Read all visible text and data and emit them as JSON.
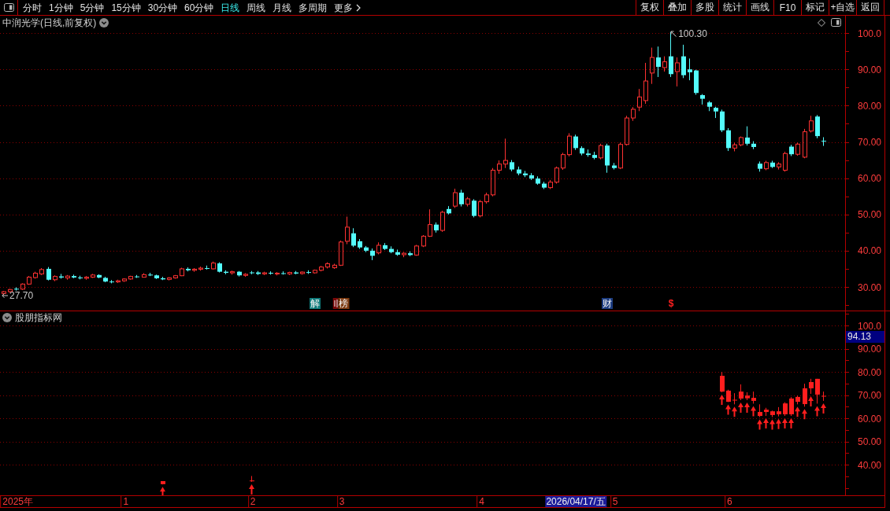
{
  "toolbar": {
    "periods": [
      {
        "label": "分时",
        "kind": "period",
        "selected": false
      },
      {
        "label": "1分钟",
        "kind": "period",
        "selected": false
      },
      {
        "label": "5分钟",
        "kind": "period",
        "selected": false
      },
      {
        "label": "15分钟",
        "kind": "period",
        "selected": false
      },
      {
        "label": "30分钟",
        "kind": "period",
        "selected": false
      },
      {
        "label": "60分钟",
        "kind": "period",
        "selected": false
      },
      {
        "label": "日线",
        "kind": "period",
        "selected": true
      },
      {
        "label": "周线",
        "kind": "period",
        "selected": false
      },
      {
        "label": "月线",
        "kind": "period",
        "selected": false
      },
      {
        "label": "多周期",
        "kind": "period",
        "selected": false
      },
      {
        "label": "更多",
        "kind": "menu",
        "selected": false
      }
    ],
    "actions": [
      "复权",
      "叠加",
      "多股",
      "统计",
      "画线",
      "F10",
      "标记",
      "+自选",
      "返回"
    ]
  },
  "main_pane": {
    "title": "中润光学(日线,前复权)",
    "high_marker": "100.30",
    "low_marker": "27.70",
    "events": [
      {
        "kind": "tag",
        "color": "#0f7a7a"
      },
      {
        "kind": "tag",
        "color": "#7d3a10",
        "covered_tag": {
          "color": "#7a0808"
        }
      },
      {
        "kind": "tag",
        "color": "#1c3c80"
      },
      {
        "kind": "symbol",
        "color": "#ff2020"
      }
    ],
    "chart_data": [
      {
        "type": "candlestick",
        "grid": true,
        "ylim": [
          23.5,
          104.8
        ],
        "yticks": [
          {
            "value": 100,
            "label": "100.0"
          },
          {
            "value": 90,
            "label": "90.00"
          },
          {
            "value": 80,
            "label": "80.00"
          },
          {
            "value": 70,
            "label": "70.00"
          },
          {
            "value": 60,
            "label": "60.00"
          },
          {
            "value": 50,
            "label": "50.00"
          },
          {
            "value": 40,
            "label": "40.00"
          },
          {
            "value": 30,
            "label": "30.00"
          }
        ],
        "categories": [
          null,
          null,
          null,
          null,
          null,
          null,
          null,
          null,
          null,
          null,
          null,
          null,
          null,
          null,
          null,
          null,
          null,
          null,
          null,
          null,
          null,
          null,
          null,
          null,
          null,
          null,
          null,
          null,
          null,
          null,
          null,
          null,
          null,
          null,
          null,
          null,
          null,
          null,
          null,
          null,
          null,
          null,
          null,
          null,
          null,
          null,
          null,
          null,
          null,
          "解",
          null,
          null,
          null,
          "榜",
          null,
          null,
          null,
          null,
          null,
          null,
          null,
          null,
          null,
          null,
          null,
          null,
          null,
          null,
          null,
          null,
          null,
          null,
          null,
          null,
          null,
          null,
          null,
          null,
          null,
          null,
          null,
          null,
          null,
          null,
          null,
          null,
          null,
          null,
          null,
          null,
          null,
          null,
          null,
          null,
          null,
          "财",
          null,
          null,
          null,
          null,
          null,
          null,
          null,
          null,
          null,
          "$",
          null,
          null,
          null,
          null,
          null,
          null,
          null,
          null,
          null,
          null,
          null,
          null,
          null,
          null,
          null,
          null,
          null,
          null,
          null,
          null,
          null,
          null,
          null,
          null,
          null,
          null,
          null
        ],
        "ohlc": [
          [
            28.2,
            28.9,
            27.7,
            28.7
          ],
          [
            28.7,
            29.5,
            28.4,
            29.3
          ],
          [
            29.4,
            29.9,
            29.0,
            29.4
          ],
          [
            29.4,
            31.0,
            29.2,
            30.8
          ],
          [
            30.8,
            33.0,
            30.6,
            32.7
          ],
          [
            32.6,
            34.2,
            32.3,
            33.8
          ],
          [
            33.6,
            35.2,
            33.3,
            34.8
          ],
          [
            35.0,
            35.5,
            31.8,
            32.0
          ],
          [
            32.0,
            33.2,
            31.6,
            32.9
          ],
          [
            32.9,
            33.6,
            32.3,
            32.6
          ],
          [
            32.5,
            33.3,
            32.0,
            33.0
          ],
          [
            33.0,
            33.4,
            32.4,
            32.6
          ],
          [
            32.6,
            33.1,
            32.1,
            32.4
          ],
          [
            32.4,
            33.0,
            32.0,
            32.7
          ],
          [
            32.7,
            33.6,
            32.5,
            33.3
          ],
          [
            33.3,
            33.5,
            32.4,
            32.6
          ],
          [
            32.5,
            32.8,
            31.3,
            31.5
          ],
          [
            31.5,
            31.9,
            31.0,
            31.4
          ],
          [
            31.4,
            32.0,
            31.1,
            31.7
          ],
          [
            31.7,
            32.4,
            31.4,
            32.2
          ],
          [
            32.2,
            33.1,
            32.0,
            32.9
          ],
          [
            32.9,
            33.3,
            32.5,
            32.7
          ],
          [
            32.7,
            33.8,
            32.6,
            33.4
          ],
          [
            33.4,
            33.9,
            33.0,
            33.3
          ],
          [
            33.2,
            33.4,
            32.2,
            32.4
          ],
          [
            32.4,
            32.8,
            31.9,
            32.1
          ],
          [
            32.1,
            32.7,
            31.8,
            32.5
          ],
          [
            32.5,
            33.3,
            32.3,
            33.1
          ],
          [
            33.1,
            35.3,
            33.0,
            35.0
          ],
          [
            35.0,
            35.4,
            34.3,
            34.6
          ],
          [
            34.6,
            35.2,
            34.2,
            34.9
          ],
          [
            34.9,
            35.6,
            34.5,
            35.2
          ],
          [
            35.2,
            35.9,
            34.8,
            35.0
          ],
          [
            35.0,
            37.0,
            34.8,
            36.6
          ],
          [
            36.5,
            36.8,
            34.0,
            34.2
          ],
          [
            34.2,
            34.6,
            33.5,
            33.9
          ],
          [
            33.9,
            34.5,
            33.4,
            34.2
          ],
          [
            34.2,
            34.4,
            32.9,
            33.2
          ],
          [
            33.2,
            33.8,
            32.8,
            33.5
          ],
          [
            33.9,
            34.4,
            33.5,
            33.9
          ],
          [
            34.0,
            34.4,
            33.3,
            33.6
          ],
          [
            33.6,
            34.2,
            33.3,
            33.9
          ],
          [
            33.9,
            34.3,
            33.4,
            33.7
          ],
          [
            33.7,
            34.1,
            33.2,
            33.8
          ],
          [
            33.8,
            34.3,
            33.4,
            33.6
          ],
          [
            33.6,
            34.2,
            33.3,
            34.0
          ],
          [
            34.0,
            34.4,
            33.5,
            33.7
          ],
          [
            33.7,
            34.3,
            33.4,
            34.1
          ],
          [
            34.1,
            34.6,
            33.6,
            33.9
          ],
          [
            33.9,
            34.8,
            33.7,
            34.6
          ],
          [
            34.6,
            35.8,
            34.3,
            35.5
          ],
          [
            35.5,
            36.8,
            35.1,
            36.4
          ],
          [
            35.3,
            36.4,
            35.0,
            36.0
          ],
          [
            36.0,
            42.8,
            35.8,
            42.4
          ],
          [
            42.6,
            49.4,
            41.8,
            46.5
          ],
          [
            44.8,
            46.2,
            41.0,
            41.4
          ],
          [
            42.6,
            43.2,
            40.5,
            40.9
          ],
          [
            40.9,
            41.3,
            39.6,
            40.0
          ],
          [
            40.0,
            40.6,
            37.4,
            38.6
          ],
          [
            39.4,
            42.3,
            39.0,
            41.5
          ],
          [
            41.5,
            42.1,
            40.2,
            40.5
          ],
          [
            40.5,
            41.2,
            39.3,
            39.6
          ],
          [
            39.6,
            40.3,
            38.6,
            38.9
          ],
          [
            38.9,
            39.6,
            38.2,
            39.3
          ],
          [
            39.3,
            39.8,
            38.5,
            38.8
          ],
          [
            38.8,
            41.6,
            38.6,
            41.3
          ],
          [
            41.3,
            44.3,
            41.0,
            44.0
          ],
          [
            44.0,
            51.4,
            43.8,
            47.2
          ],
          [
            47.2,
            47.8,
            45.0,
            45.6
          ],
          [
            45.6,
            51.0,
            45.2,
            50.6
          ],
          [
            51.5,
            52.3,
            50.0,
            50.3
          ],
          [
            52.3,
            57.1,
            51.8,
            56.0
          ],
          [
            56.0,
            56.8,
            52.2,
            52.8
          ],
          [
            52.8,
            54.8,
            52.2,
            54.3
          ],
          [
            53.8,
            54.2,
            49.2,
            49.6
          ],
          [
            49.6,
            54.0,
            49.2,
            53.5
          ],
          [
            53.5,
            56.0,
            53.0,
            55.4
          ],
          [
            55.4,
            62.8,
            55.0,
            62.2
          ],
          [
            62.2,
            64.9,
            61.2,
            63.9
          ],
          [
            63.9,
            70.9,
            62.8,
            64.9
          ],
          [
            64.4,
            65.0,
            61.9,
            62.4
          ],
          [
            62.4,
            63.2,
            60.8,
            61.3
          ],
          [
            61.3,
            62.0,
            60.3,
            60.8
          ],
          [
            60.8,
            61.4,
            59.5,
            59.9
          ],
          [
            59.9,
            60.5,
            58.2,
            58.5
          ],
          [
            58.5,
            59.0,
            57.0,
            57.4
          ],
          [
            57.4,
            59.5,
            57.0,
            58.9
          ],
          [
            58.9,
            63.2,
            58.5,
            62.8
          ],
          [
            62.8,
            67.0,
            62.3,
            66.5
          ],
          [
            66.5,
            72.4,
            66.0,
            71.6
          ],
          [
            71.5,
            72.0,
            67.8,
            68.3
          ],
          [
            68.3,
            68.8,
            66.3,
            66.8
          ],
          [
            66.8,
            67.9,
            65.9,
            66.4
          ],
          [
            66.4,
            67.3,
            65.2,
            65.6
          ],
          [
            65.6,
            69.5,
            65.2,
            69.0
          ],
          [
            69.0,
            69.5,
            61.5,
            63.5
          ],
          [
            63.5,
            64.2,
            62.4,
            62.8
          ],
          [
            62.8,
            69.8,
            62.5,
            69.3
          ],
          [
            69.3,
            77.2,
            69.0,
            76.6
          ],
          [
            76.6,
            79.6,
            75.8,
            79.0
          ],
          [
            79.6,
            84.6,
            78.5,
            82.4
          ],
          [
            81.4,
            91.8,
            80.5,
            86.8
          ],
          [
            89.0,
            96.0,
            86.0,
            93.3
          ],
          [
            93.3,
            96.3,
            87.9,
            90.7
          ],
          [
            90.5,
            93.6,
            89.4,
            92.1
          ],
          [
            93.6,
            100.3,
            87.9,
            88.7
          ],
          [
            89.4,
            93.3,
            85.3,
            91.8
          ],
          [
            93.6,
            96.8,
            87.6,
            88.4
          ],
          [
            90.0,
            93.0,
            87.0,
            89.2
          ],
          [
            89.7,
            89.9,
            83.0,
            83.5
          ],
          [
            82.9,
            83.2,
            80.3,
            81.9
          ],
          [
            80.9,
            81.3,
            78.5,
            79.7
          ],
          [
            79.4,
            79.7,
            76.6,
            78.4
          ],
          [
            78.4,
            78.9,
            72.7,
            73.2
          ],
          [
            73.2,
            73.8,
            67.5,
            68.3
          ],
          [
            68.3,
            69.8,
            67.4,
            69.2
          ],
          [
            69.2,
            71.5,
            68.8,
            71.2
          ],
          [
            71.2,
            74.3,
            69.0,
            69.5
          ],
          [
            69.5,
            70.2,
            68.0,
            68.6
          ],
          [
            64.0,
            64.6,
            61.8,
            62.6
          ],
          [
            62.6,
            64.8,
            62.2,
            64.3
          ],
          [
            64.3,
            64.8,
            62.8,
            63.1
          ],
          [
            63.1,
            64.4,
            62.4,
            63.9
          ],
          [
            62.2,
            67.3,
            61.8,
            66.8
          ],
          [
            68.7,
            69.2,
            66.1,
            66.6
          ],
          [
            66.6,
            69.8,
            66.2,
            69.4
          ],
          [
            65.8,
            73.6,
            65.5,
            72.8
          ],
          [
            73.0,
            77.2,
            72.6,
            75.8
          ],
          [
            77.0,
            77.4,
            71.0,
            71.6
          ],
          [
            70.2,
            71.3,
            68.9,
            70.2
          ],
          null,
          null,
          null
        ],
        "colors": [
          "#ff3232",
          "#ff3232",
          "#54fcfc",
          "#ff3232",
          "#ff3232",
          "#ff3232",
          "#ff3232",
          "#54fcfc",
          "#ff3232",
          "#54fcfc",
          "#ff3232",
          "#54fcfc",
          "#54fcfc",
          "#ff3232",
          "#ff3232",
          "#54fcfc",
          "#54fcfc",
          "#54fcfc",
          "#ff3232",
          "#ff3232",
          "#ff3232",
          "#54fcfc",
          "#ff3232",
          "#54fcfc",
          "#54fcfc",
          "#54fcfc",
          "#ff3232",
          "#ff3232",
          "#ff3232",
          "#54fcfc",
          "#ff3232",
          "#ff3232",
          "#54fcfc",
          "#ff3232",
          "#54fcfc",
          "#54fcfc",
          "#ff3232",
          "#54fcfc",
          "#ff3232",
          "#54fcfc",
          "#54fcfc",
          "#ff3232",
          "#54fcfc",
          "#ff3232",
          "#54fcfc",
          "#ff3232",
          "#54fcfc",
          "#ff3232",
          "#54fcfc",
          "#ff3232",
          "#ff3232",
          "#ff3232",
          "#ff3232",
          "#ff3232",
          "#ff3232",
          "#54fcfc",
          "#54fcfc",
          "#54fcfc",
          "#54fcfc",
          "#ff3232",
          "#54fcfc",
          "#54fcfc",
          "#54fcfc",
          "#ff3232",
          "#54fcfc",
          "#ff3232",
          "#ff3232",
          "#ff3232",
          "#54fcfc",
          "#ff3232",
          "#54fcfc",
          "#ff3232",
          "#54fcfc",
          "#ff3232",
          "#54fcfc",
          "#ff3232",
          "#ff3232",
          "#ff3232",
          "#ff3232",
          "#ff3232",
          "#54fcfc",
          "#54fcfc",
          "#54fcfc",
          "#54fcfc",
          "#54fcfc",
          "#54fcfc",
          "#ff3232",
          "#ff3232",
          "#ff3232",
          "#ff3232",
          "#54fcfc",
          "#54fcfc",
          "#54fcfc",
          "#54fcfc",
          "#ff3232",
          "#54fcfc",
          "#54fcfc",
          "#ff3232",
          "#ff3232",
          "#ff3232",
          "#ff3232",
          "#ff3232",
          "#ff3232",
          "#54fcfc",
          "#ff3232",
          "#54fcfc",
          "#ff3232",
          "#54fcfc",
          "#54fcfc",
          "#54fcfc",
          "#54fcfc",
          "#54fcfc",
          "#54fcfc",
          "#54fcfc",
          "#54fcfc",
          "#ff3232",
          "#ff3232",
          "#54fcfc",
          "#54fcfc",
          "#54fcfc",
          "#ff3232",
          "#54fcfc",
          "#ff3232",
          "#ff3232",
          "#54fcfc",
          "#ff3232",
          "#ff3232",
          "#ff3232",
          "#54fcfc",
          "#54fcfc",
          null,
          null,
          null
        ]
      }
    ]
  },
  "indicator_pane": {
    "title": "股朋指标网",
    "cursor_value": "94.13",
    "chart_data": [
      {
        "type": "candlestick",
        "grid": true,
        "color": "#ff1e1e",
        "marker": "arrow",
        "ylim": [
          26.8,
          106.1
        ],
        "yticks": [
          {
            "value": 100,
            "label": "100.0"
          },
          {
            "value": 90,
            "label": "90.00"
          },
          {
            "value": 80,
            "label": "80.00"
          },
          {
            "value": 70,
            "label": "70.00"
          },
          {
            "value": 60,
            "label": "60.00"
          },
          {
            "value": 50,
            "label": "50.00"
          },
          {
            "value": 40,
            "label": "40.00"
          }
        ],
        "categories": [
          null,
          null,
          "2025年",
          null,
          null,
          null,
          null,
          null,
          null,
          null,
          null,
          null,
          null,
          null,
          null,
          null,
          null,
          null,
          null,
          "1",
          null,
          null,
          null,
          null,
          null,
          null,
          null,
          null,
          null,
          null,
          null,
          null,
          null,
          null,
          null,
          null,
          null,
          null,
          null,
          "2",
          null,
          null,
          null,
          null,
          null,
          null,
          null,
          null,
          null,
          null,
          null,
          null,
          null,
          "3",
          null,
          null,
          null,
          null,
          null,
          null,
          null,
          null,
          null,
          null,
          null,
          null,
          null,
          null,
          null,
          null,
          null,
          null,
          null,
          null,
          null,
          "4",
          null,
          null,
          null,
          null,
          null,
          null,
          null,
          null,
          null,
          null,
          null,
          null,
          null,
          null,
          "2026/04/17/五",
          null,
          null,
          null,
          null,
          null,
          "5",
          null,
          null,
          null,
          null,
          null,
          null,
          null,
          null,
          null,
          null,
          null,
          null,
          null,
          null,
          null,
          null,
          null,
          "6",
          null,
          null,
          null,
          null,
          null,
          null,
          null,
          null,
          null,
          null,
          null,
          null,
          null,
          null,
          null,
          null,
          null,
          null
        ],
        "ohlc": [
          null,
          null,
          null,
          null,
          null,
          null,
          null,
          null,
          null,
          null,
          null,
          null,
          null,
          null,
          null,
          null,
          null,
          null,
          null,
          null,
          null,
          null,
          null,
          null,
          null,
          [
            31.6,
            32.9,
            31.5,
            32.9
          ],
          null,
          null,
          null,
          null,
          null,
          null,
          null,
          null,
          null,
          null,
          null,
          null,
          null,
          [
            33.0,
            35.1,
            32.6,
            33.0
          ],
          null,
          null,
          null,
          null,
          null,
          null,
          null,
          null,
          null,
          null,
          null,
          null,
          null,
          null,
          null,
          null,
          null,
          null,
          null,
          null,
          null,
          null,
          null,
          null,
          null,
          null,
          null,
          null,
          null,
          null,
          null,
          null,
          null,
          null,
          null,
          null,
          null,
          null,
          null,
          null,
          null,
          null,
          null,
          null,
          null,
          null,
          null,
          null,
          null,
          null,
          null,
          null,
          null,
          null,
          null,
          null,
          null,
          null,
          null,
          null,
          null,
          null,
          null,
          null,
          null,
          null,
          null,
          null,
          null,
          null,
          null,
          null,
          null,
          [
            71.5,
            80.0,
            71.2,
            78.3
          ],
          [
            67.1,
            72.3,
            67.0,
            71.9
          ],
          [
            67.8,
            70.8,
            66.0,
            67.8
          ],
          [
            68.5,
            74.6,
            67.8,
            71.5
          ],
          [
            68.6,
            71.2,
            67.8,
            69.8
          ],
          [
            67.5,
            71.5,
            66.3,
            68.8
          ],
          [
            61.0,
            66.0,
            60.5,
            62.7
          ],
          [
            62.7,
            64.5,
            61.0,
            63.7
          ],
          [
            61.4,
            63.3,
            60.5,
            63.0
          ],
          [
            61.7,
            64.8,
            60.8,
            63.0
          ],
          [
            61.7,
            66.9,
            61.0,
            66.4
          ],
          [
            61.7,
            69.1,
            61.0,
            68.5
          ],
          [
            67.1,
            69.8,
            66.0,
            69.2
          ],
          [
            66.1,
            74.9,
            65.0,
            72.9
          ],
          [
            72.9,
            77.0,
            70.5,
            75.6
          ],
          [
            70.2,
            77.0,
            66.3,
            77.0
          ],
          [
            69.5,
            71.5,
            67.5,
            69.5
          ],
          null,
          null,
          null
        ]
      }
    ]
  },
  "time_axis": {
    "label_states": [
      {
        "selected": false
      },
      {
        "selected": false
      },
      {
        "selected": false
      },
      {
        "selected": false
      },
      {
        "selected": false
      },
      {
        "selected": true
      },
      {
        "selected": false
      },
      {
        "selected": false
      }
    ]
  }
}
